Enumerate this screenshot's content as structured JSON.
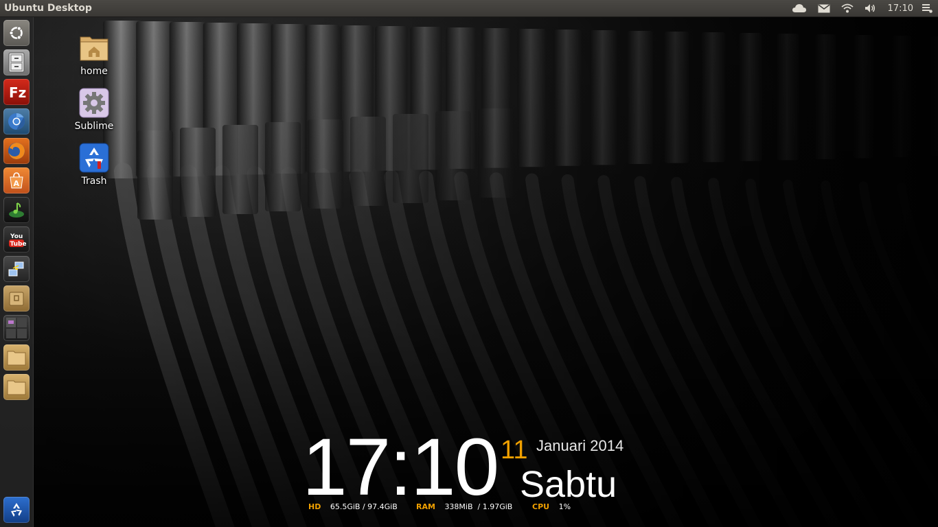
{
  "top_panel": {
    "title": "Ubuntu Desktop",
    "clock": "17:10",
    "indicators": [
      "cloud-icon",
      "mail-icon",
      "wifi-icon",
      "volume-icon",
      "session-menu-icon"
    ]
  },
  "launcher": {
    "items": [
      {
        "name": "dash-home",
        "icon": "ubuntu-logo-icon"
      },
      {
        "name": "file-cabinet",
        "icon": "file-cabinet-icon"
      },
      {
        "name": "filezilla",
        "icon": "filezilla-icon"
      },
      {
        "name": "chromium",
        "icon": "chromium-icon"
      },
      {
        "name": "firefox",
        "icon": "firefox-icon"
      },
      {
        "name": "software-center",
        "icon": "software-center-icon"
      },
      {
        "name": "music-player",
        "icon": "music-player-icon"
      },
      {
        "name": "youtube",
        "icon": "youtube-icon"
      },
      {
        "name": "network-tool",
        "icon": "network-tool-icon"
      },
      {
        "name": "archive-manager",
        "icon": "archive-icon"
      },
      {
        "name": "workspace-switcher",
        "icon": "workspace-switcher-icon"
      },
      {
        "name": "folder-1",
        "icon": "folder-icon"
      },
      {
        "name": "folder-2",
        "icon": "folder-icon"
      },
      {
        "name": "trash",
        "icon": "trash-icon"
      }
    ]
  },
  "desktop_icons": [
    {
      "label": "home",
      "icon": "home-folder-icon"
    },
    {
      "label": "Sublime",
      "icon": "gear-icon"
    },
    {
      "label": "Trash",
      "icon": "recycle-icon"
    }
  ],
  "conky": {
    "time": "17:10",
    "day": "11",
    "month_year": "Januari 2014",
    "weekday": "Sabtu",
    "hd_label": "HD",
    "hd_value": "65.5GiB / 97.4GiB",
    "ram_label": "RAM",
    "ram_value": "338MiB  / 1.97GiB",
    "cpu_label": "CPU",
    "cpu_value": "1%"
  },
  "colors": {
    "accent": "#f0a000",
    "panel": "#3c3b37",
    "text": "#dfdbd2"
  }
}
